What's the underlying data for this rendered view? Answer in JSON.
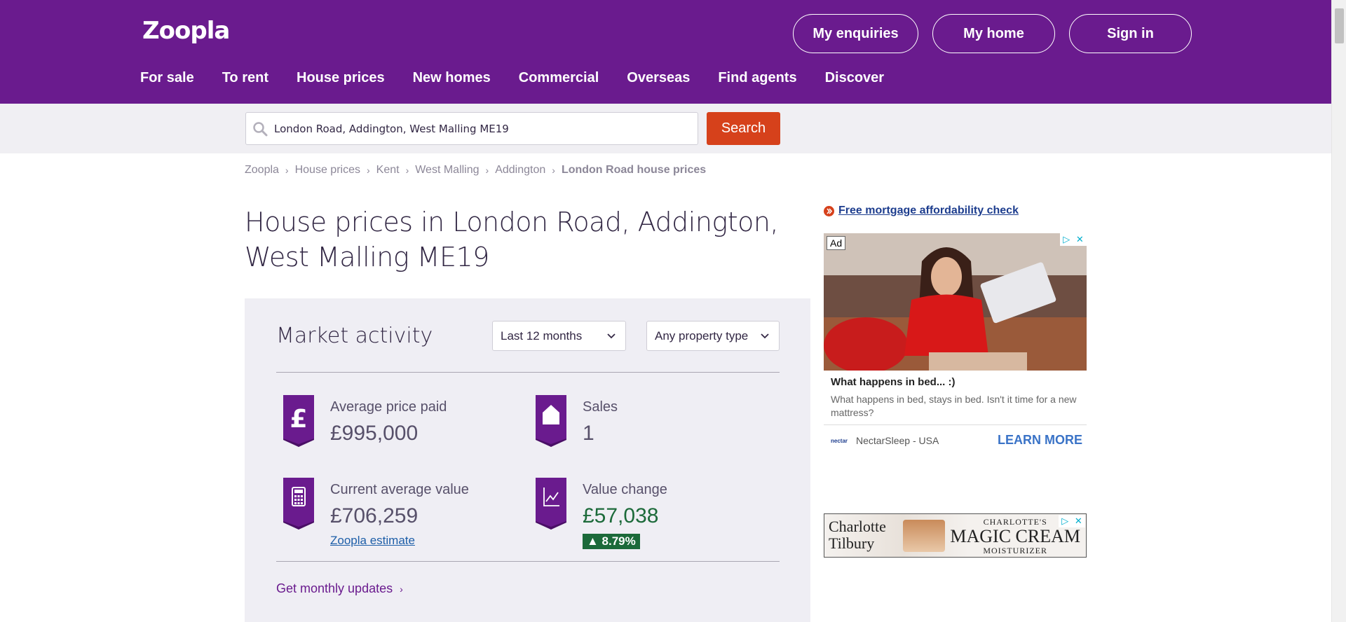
{
  "header": {
    "logo": "Zoopla",
    "buttons": [
      "My enquiries",
      "My home",
      "Sign in"
    ],
    "nav": [
      "For sale",
      "To rent",
      "House prices",
      "New homes",
      "Commercial",
      "Overseas",
      "Find agents",
      "Discover"
    ],
    "brand_color": "#6a1b8e"
  },
  "search": {
    "value": "London Road, Addington, West Malling ME19",
    "button_label": "Search",
    "button_color": "#d6411b"
  },
  "breadcrumb": [
    "Zoopla",
    "House prices",
    "Kent",
    "West Malling",
    "Addington",
    "London Road house prices"
  ],
  "page_title": "House prices in London Road, Addington, West Malling ME19",
  "market": {
    "title": "Market activity",
    "period_select": "Last 12 months",
    "type_select": "Any property type",
    "stats": {
      "avg_price": {
        "label": "Average price paid",
        "value": "£995,000",
        "icon": "pound-icon"
      },
      "sales": {
        "label": "Sales",
        "value": "1",
        "icon": "house-icon"
      },
      "current_value": {
        "label": "Current average value",
        "value": "£706,259",
        "link": "Zoopla estimate",
        "icon": "calculator-icon"
      },
      "value_change": {
        "label": "Value change",
        "value": "£57,038",
        "badge": "▲ 8.79%",
        "icon": "chart-icon"
      }
    },
    "monthly_link": "Get monthly updates"
  },
  "sidebar": {
    "mortgage_link": "Free mortgage affordability check",
    "ad1": {
      "tag": "Ad",
      "headline": "What happens in bed... :)",
      "body": "What happens in bed, stays in bed. Isn't it time for a new mattress?",
      "brand_mini": "nectar",
      "advertiser": "NectarSleep - USA",
      "cta": "LEARN MORE"
    },
    "ad2": {
      "left": "Charlotte Tilbury",
      "right_top": "CHARLOTTE'S",
      "right_big": "MAGIC CREAM",
      "right_bottom": "MOISTURIZER"
    }
  }
}
